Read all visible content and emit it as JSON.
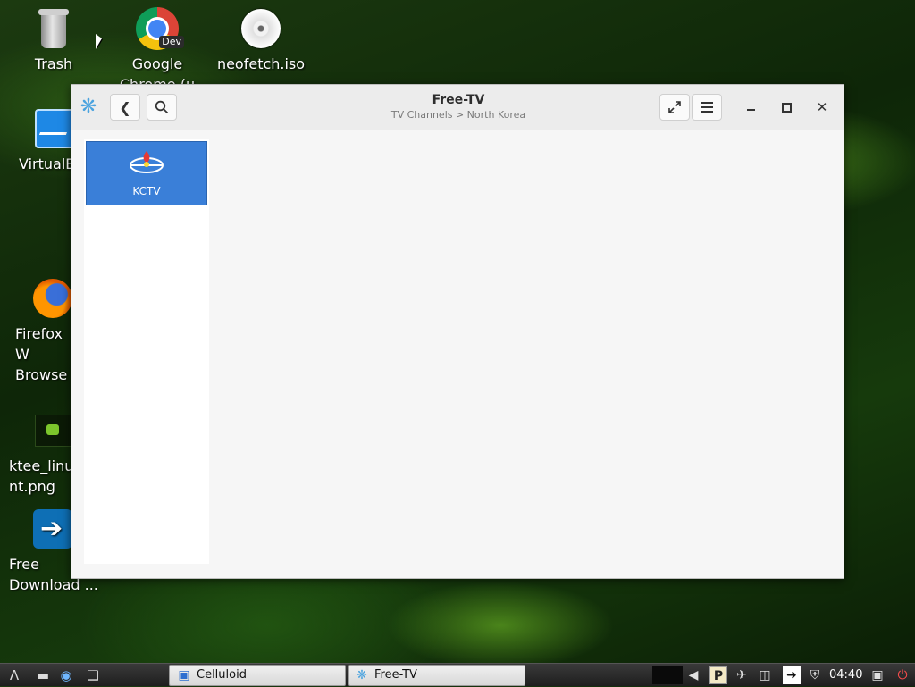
{
  "desktop": {
    "icons": [
      {
        "label": "Trash",
        "icon": "trash-icon"
      },
      {
        "label": "Google\nChrome (u",
        "icon": "chrome-dev-icon",
        "badge": "Dev"
      },
      {
        "label": "neofetch.iso",
        "icon": "disc-image-icon"
      },
      {
        "label": "VirtualB",
        "icon": "virtualbox-icon"
      },
      {
        "label": "Firefox W\nBrowse",
        "icon": "firefox-icon"
      },
      {
        "label": "ktee_linu\nnt.png",
        "icon": "image-file-icon"
      },
      {
        "label": "Free\nDownload ...",
        "icon": "free-download-manager-icon"
      }
    ]
  },
  "window": {
    "title": "Free-TV",
    "subtitle": "TV Channels > North Korea",
    "icons": {
      "app": "freetv-app-icon",
      "back": "back-arrow-icon",
      "search": "search-icon",
      "fullscreen": "fullscreen-icon",
      "menu": "hamburger-menu-icon",
      "minimize": "minimize-icon",
      "maximize": "maximize-icon",
      "close": "close-icon"
    },
    "channels": [
      {
        "label": "KCTV",
        "selected": true,
        "icon": "kctv-logo-icon"
      }
    ]
  },
  "taskbar": {
    "tasks": [
      {
        "label": "Celluloid",
        "icon": "celluloid-icon"
      },
      {
        "label": "Free-TV",
        "icon": "freetv-app-icon"
      }
    ],
    "clock": "04:40",
    "colors": {
      "selection": "#3a7fd8",
      "power": "#ff4d4d"
    }
  }
}
